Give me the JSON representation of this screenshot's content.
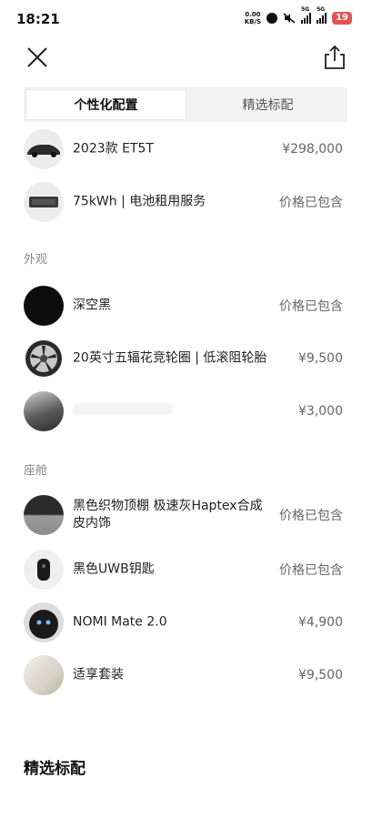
{
  "status_bar": {
    "time": "18:21",
    "net_speed_value": "0.00",
    "net_speed_unit": "KB/S",
    "signal1": "5G",
    "signal2": "5G",
    "battery": "19"
  },
  "tabs": [
    {
      "label": "个性化配置",
      "active": true
    },
    {
      "label": "精选标配",
      "active": false
    }
  ],
  "items_top": [
    {
      "name": "2023款 ET5T",
      "price": "¥298,000",
      "icon": "car-icon"
    },
    {
      "name": "75kWh | 电池租用服务",
      "price": "价格已包含",
      "icon": "battery-pack-icon"
    }
  ],
  "exterior": {
    "section_label": "外观",
    "items": [
      {
        "name": "深空黑",
        "price": "价格已包含",
        "icon": "black-paint-swatch"
      },
      {
        "name": "20英寸五辐花竞轮圈 | 低滚阻轮胎",
        "price": "¥9,500",
        "icon": "wheel-icon"
      },
      {
        "name": "",
        "price": "¥3,000",
        "icon": "roof-detail-icon"
      }
    ]
  },
  "cabin": {
    "section_label": "座舱",
    "items": [
      {
        "name": "黑色织物顶棚 极速灰Haptex合成皮内饰",
        "price": "价格已包含",
        "icon": "interior-swatch-icon"
      },
      {
        "name": "黑色UWB钥匙",
        "price": "价格已包含",
        "icon": "key-icon"
      },
      {
        "name": "NOMI Mate 2.0",
        "price": "¥4,900",
        "icon": "nomi-robot-icon"
      },
      {
        "name": "适享套装",
        "price": "¥9,500",
        "icon": "comfort-pack-icon"
      }
    ]
  },
  "bottom_section_title": "精选标配"
}
